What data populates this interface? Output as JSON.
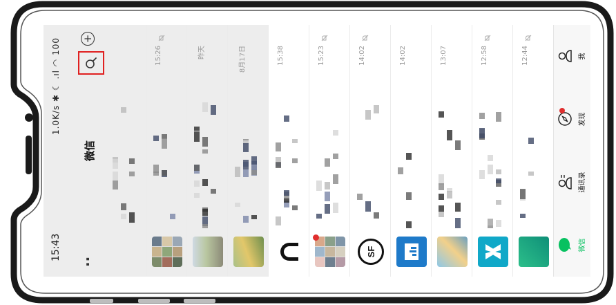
{
  "status_bar": {
    "time": "15:43",
    "indicators": "1.0K/s ✱ ☾ .ıl ◠ 100"
  },
  "header": {
    "more": "··",
    "title": "微信",
    "search_icon": "search-icon",
    "add_icon": "add-circle-icon"
  },
  "chats": [
    {
      "time": "",
      "muted": false,
      "avatar": "pinned",
      "bg": "gray"
    },
    {
      "time": "15:26",
      "muted": true,
      "avatar": "photo-collage-1",
      "bg": "gray"
    },
    {
      "time": "昨天",
      "muted": false,
      "avatar": "photo-street",
      "bg": "gray"
    },
    {
      "time": "8月17日",
      "muted": false,
      "avatar": "photo-outdoor",
      "bg": "gray"
    },
    {
      "time": "15:38",
      "muted": false,
      "avatar": "logo-dark-u",
      "bg": "white"
    },
    {
      "time": "15:23",
      "muted": true,
      "avatar": "photo-collage-2",
      "bg": "white"
    },
    {
      "time": "14:02",
      "muted": true,
      "avatar": "logo-sf",
      "bg": "white"
    },
    {
      "time": "14:02",
      "muted": false,
      "avatar": "logo-blue-chart",
      "bg": "white"
    },
    {
      "time": "13:07",
      "muted": false,
      "avatar": "photo-cartoon",
      "bg": "white"
    },
    {
      "time": "12:58",
      "muted": true,
      "avatar": "logo-teal",
      "bg": "white"
    },
    {
      "time": "12:44",
      "muted": true,
      "avatar": "logo-green-card",
      "bg": "white"
    }
  ],
  "tabs": [
    {
      "label": "微信",
      "icon": "chat-icon",
      "active": true
    },
    {
      "label": "通讯录",
      "icon": "contacts-icon",
      "active": false
    },
    {
      "label": "发现",
      "icon": "compass-icon",
      "active": false,
      "dot": true
    },
    {
      "label": "我",
      "icon": "person-icon",
      "active": false
    }
  ],
  "colors": {
    "accent_green": "#07c160",
    "highlight_red": "#e02020",
    "header_gray": "#ededed"
  }
}
